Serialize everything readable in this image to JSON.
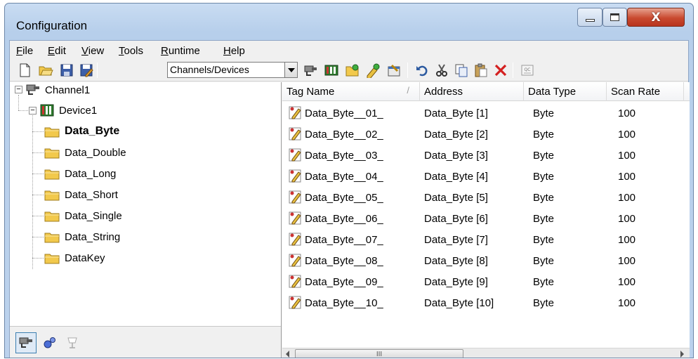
{
  "window": {
    "title": "Configuration"
  },
  "menu": [
    "File",
    "Edit",
    "View",
    "Tools",
    "Runtime",
    "Help"
  ],
  "toolbar": {
    "view_selector": "Channels/Devices"
  },
  "tree": {
    "channel": "Channel1",
    "device": "Device1",
    "groups": [
      "Data_Byte",
      "Data_Double",
      "Data_Long",
      "Data_Short",
      "Data_Single",
      "Data_String",
      "DataKey"
    ],
    "selected_group": "Data_Byte"
  },
  "table": {
    "columns": [
      "Tag Name",
      "Address",
      "Data Type",
      "Scan Rate"
    ],
    "sort_indicator": "/",
    "rows": [
      [
        "Data_Byte__01_",
        "Data_Byte [1]",
        "Byte",
        "100"
      ],
      [
        "Data_Byte__02_",
        "Data_Byte [2]",
        "Byte",
        "100"
      ],
      [
        "Data_Byte__03_",
        "Data_Byte [3]",
        "Byte",
        "100"
      ],
      [
        "Data_Byte__04_",
        "Data_Byte [4]",
        "Byte",
        "100"
      ],
      [
        "Data_Byte__05_",
        "Data_Byte [5]",
        "Byte",
        "100"
      ],
      [
        "Data_Byte__06_",
        "Data_Byte [6]",
        "Byte",
        "100"
      ],
      [
        "Data_Byte__07_",
        "Data_Byte [7]",
        "Byte",
        "100"
      ],
      [
        "Data_Byte__08_",
        "Data_Byte [8]",
        "Byte",
        "100"
      ],
      [
        "Data_Byte__09_",
        "Data_Byte [9]",
        "Byte",
        "100"
      ],
      [
        "Data_Byte__10_",
        "Data_Byte [10]",
        "Byte",
        "100"
      ]
    ]
  },
  "scrollbar": {
    "thumb_grip": "III"
  },
  "colors": {
    "folder": "#f2c94c",
    "selection_border": "#3c7fb1",
    "close_button": "#c9492f"
  },
  "icons": {
    "toolbar": [
      "new-file-icon",
      "open-folder-icon",
      "save-icon",
      "save-as-icon",
      "new-channel-icon",
      "new-device-icon",
      "new-tag-group-icon",
      "new-tag-icon",
      "properties-icon",
      "undo-icon",
      "cut-icon",
      "copy-icon",
      "paste-icon",
      "delete-icon",
      "quick-client-icon"
    ],
    "footer": [
      "channels-view-icon",
      "aliases-view-icon",
      "events-view-icon"
    ]
  }
}
